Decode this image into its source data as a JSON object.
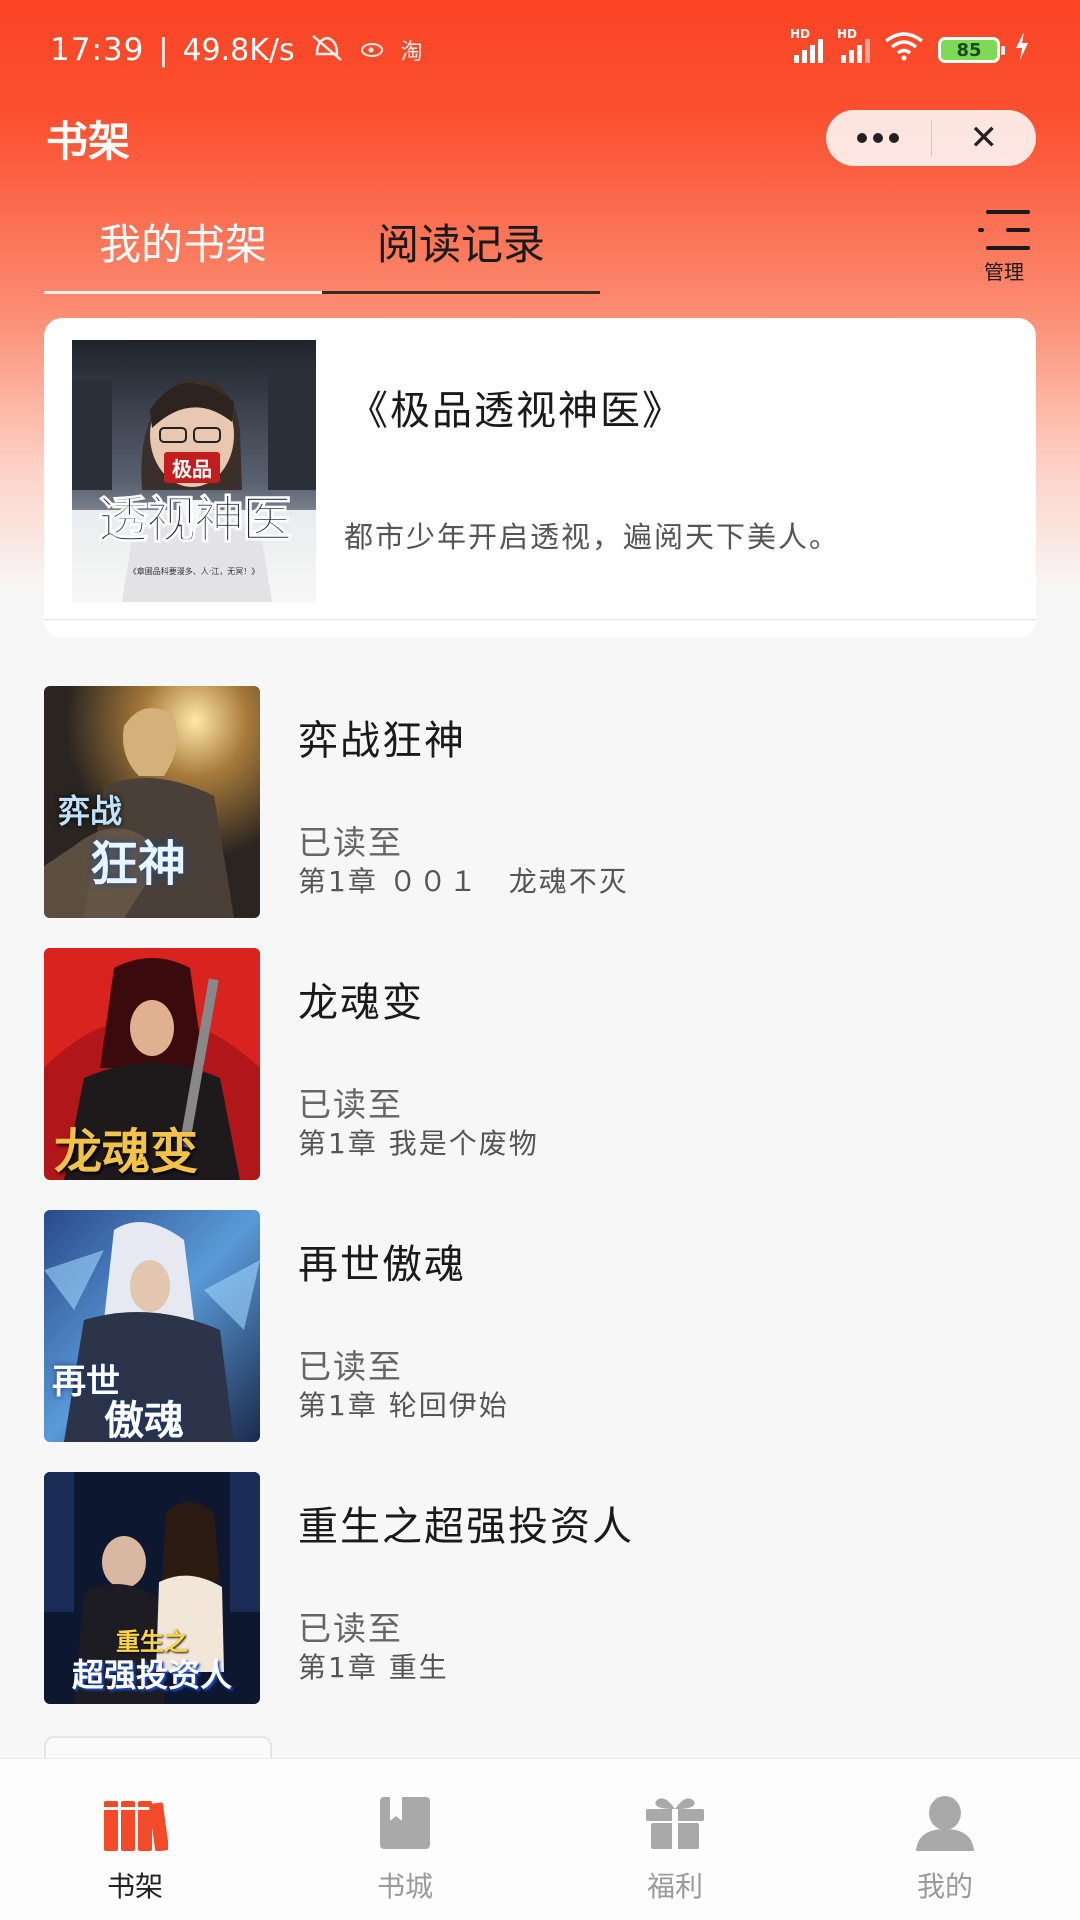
{
  "status_bar": {
    "time": "17:39",
    "speed": "49.8K/s",
    "taobao_icon_text": "淘",
    "battery": "85"
  },
  "nav": {
    "title": "书架"
  },
  "tabs": [
    {
      "label": "我的书架"
    },
    {
      "label": "阅读记录"
    }
  ],
  "manage_label": "管理",
  "featured": {
    "title": "《极品透视神医》",
    "description": "都市少年开启透视，遍阅天下美人。",
    "cover_small": "极品",
    "cover_big": "透视神医",
    "cover_tag": "《章圃品科要漫多、人·江，无冥！》"
  },
  "books": [
    {
      "title": "弈战狂神",
      "read_label": "已读至",
      "chapter": "第1章 ００１　龙魂不灭",
      "cover_text_1": "弈战",
      "cover_text_2": "狂神"
    },
    {
      "title": "龙魂变",
      "read_label": "已读至",
      "chapter": "第1章 我是个废物",
      "cover_text_1": "龙魂变"
    },
    {
      "title": "再世傲魂",
      "read_label": "已读至",
      "chapter": "第1章 轮回伊始",
      "cover_text_1": "再世",
      "cover_text_2": "傲魂"
    },
    {
      "title": "重生之超强投资人",
      "read_label": "已读至",
      "chapter": "第1章 重生",
      "cover_text_1": "重生之",
      "cover_text_2": "超强投资人"
    }
  ],
  "tabbar": [
    {
      "label": "书架",
      "icon": "bookshelf-icon"
    },
    {
      "label": "书城",
      "icon": "book-icon"
    },
    {
      "label": "福利",
      "icon": "gift-icon"
    },
    {
      "label": "我的",
      "icon": "user-icon"
    }
  ],
  "colors": {
    "accent": "#fa4a2c",
    "header_red": "#fb4424",
    "text_dark": "#1a1a1a",
    "text_gray": "#9a9a9a"
  }
}
